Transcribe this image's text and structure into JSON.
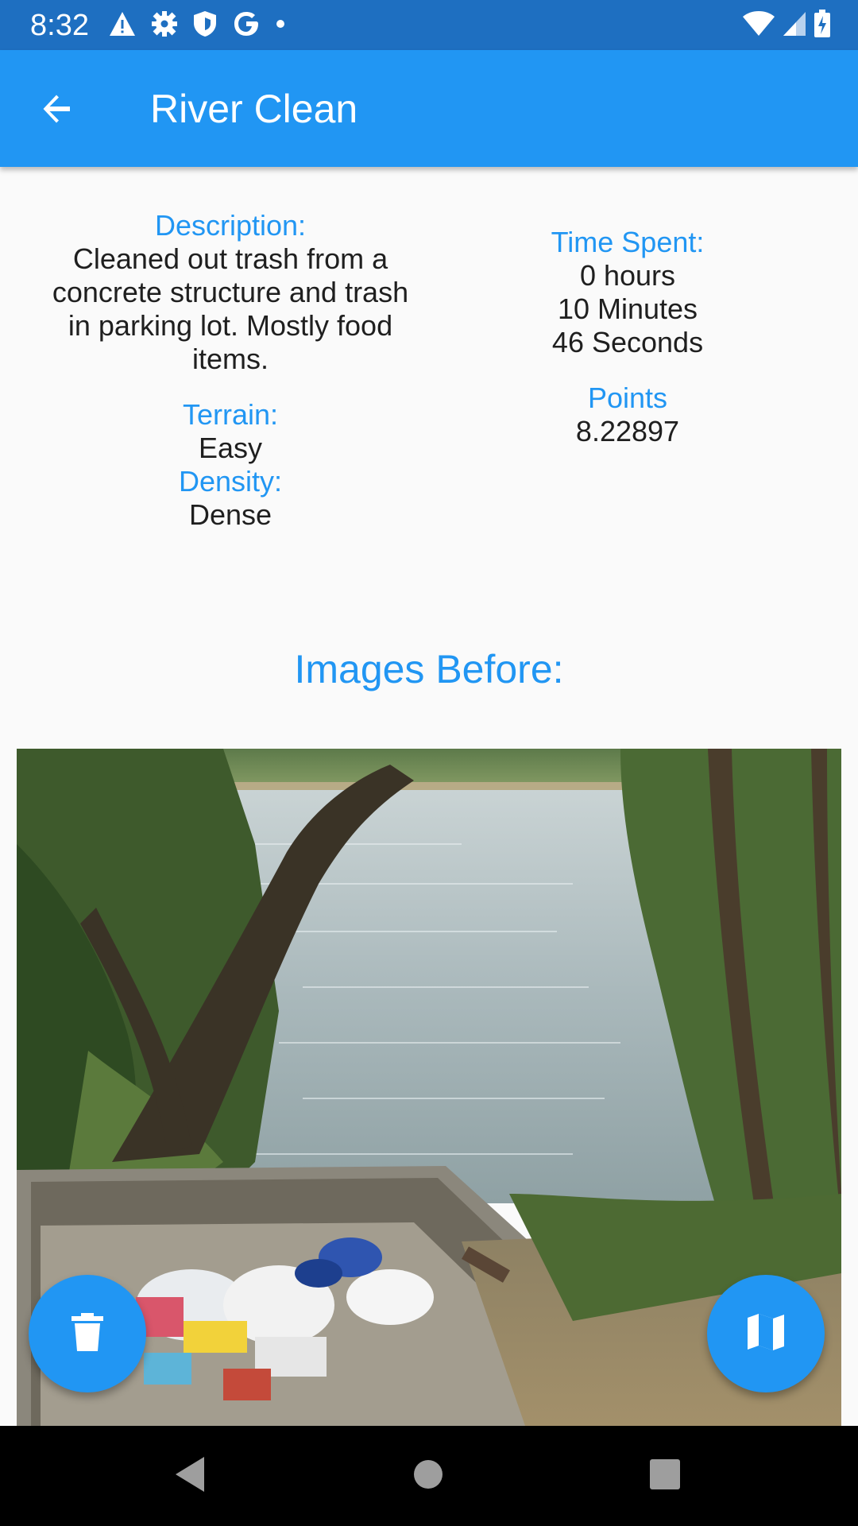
{
  "status_bar": {
    "time": "8:32",
    "left_icons": [
      "warning-icon",
      "settings-icon",
      "shield-icon",
      "google-icon",
      "dot-icon"
    ],
    "right_icons": [
      "wifi-icon",
      "signal-icon",
      "battery-icon"
    ]
  },
  "app_bar": {
    "title": "River Clean",
    "back_icon": "arrow-back-icon",
    "color": "#2196f3",
    "status_color": "#1e6fc1"
  },
  "details": {
    "description_label": "Description:",
    "description_lines": [
      "Cleaned out trash from a",
      "concrete structure and trash",
      "in parking lot. Mostly food",
      "items."
    ],
    "terrain_label": "Terrain:",
    "terrain_value": "Easy",
    "density_label": "Density:",
    "density_value": "Dense",
    "time_label": "Time Spent:",
    "time_hours": "0 hours",
    "time_minutes": "10 Minutes",
    "time_seconds": "46 Seconds",
    "points_label": "Points",
    "points_value": "8.22897"
  },
  "images": {
    "heading": "Images Before:",
    "photo_description": "river-bank-trash-photo"
  },
  "fabs": {
    "delete_icon": "trash-icon",
    "map_icon": "map-icon"
  },
  "nav_bar": {
    "icons": [
      "nav-back-icon",
      "nav-home-icon",
      "nav-recents-icon"
    ]
  },
  "colors": {
    "accent": "#2196f3",
    "text": "#1f1f1f",
    "background": "#fafafa"
  }
}
